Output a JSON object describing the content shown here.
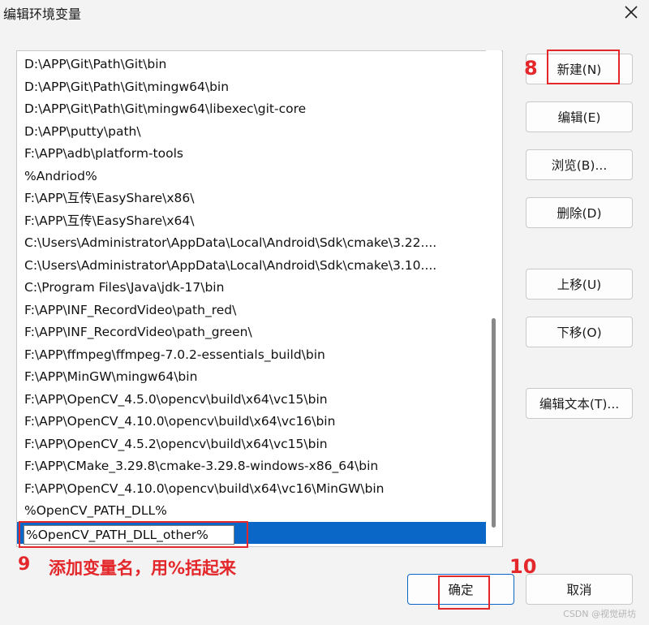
{
  "window": {
    "title": "编辑环境变量",
    "close_icon": "close-icon"
  },
  "path_list": {
    "items": [
      "D:\\APP\\Git\\Path\\Git\\bin",
      "D:\\APP\\Git\\Path\\Git\\mingw64\\bin",
      "D:\\APP\\Git\\Path\\Git\\mingw64\\libexec\\git-core",
      "D:\\APP\\putty\\path\\",
      "F:\\APP\\adb\\platform-tools",
      "%Andriod%",
      "F:\\APP\\互传\\EasyShare\\x86\\",
      "F:\\APP\\互传\\EasyShare\\x64\\",
      "C:\\Users\\Administrator\\AppData\\Local\\Android\\Sdk\\cmake\\3.22....",
      "C:\\Users\\Administrator\\AppData\\Local\\Android\\Sdk\\cmake\\3.10....",
      "C:\\Program Files\\Java\\jdk-17\\bin",
      "F:\\APP\\INF_RecordVideo\\path_red\\",
      "F:\\APP\\INF_RecordVideo\\path_green\\",
      "F:\\APP\\ffmpeg\\ffmpeg-7.0.2-essentials_build\\bin",
      "F:\\APP\\MinGW\\mingw64\\bin",
      "F:\\APP\\OpenCV_4.5.0\\opencv\\build\\x64\\vc15\\bin",
      "F:\\APP\\OpenCV_4.10.0\\opencv\\build\\x64\\vc16\\bin",
      "F:\\APP\\OpenCV_4.5.2\\opencv\\build\\x64\\vc15\\bin",
      "F:\\APP\\CMake_3.29.8\\cmake-3.29.8-windows-x86_64\\bin",
      "F:\\APP\\OpenCV_4.10.0\\opencv\\build\\x64\\vc16\\MinGW\\bin",
      "%OpenCV_PATH_DLL%"
    ],
    "editing_value": "%OpenCV_PATH_DLL_other%",
    "selection_color": "#0a67c7"
  },
  "buttons": {
    "new": "新建(N)",
    "edit": "编辑(E)",
    "browse": "浏览(B)...",
    "delete": "删除(D)",
    "move_up": "上移(U)",
    "move_down": "下移(O)",
    "edit_text": "编辑文本(T)...",
    "ok": "确定",
    "cancel": "取消"
  },
  "annotations": {
    "step8": "8",
    "step9": "9",
    "step9_text": "添加变量名，用%括起来",
    "step10": "10",
    "color": "#e3272b"
  },
  "watermark": "CSDN @视觉研坊"
}
